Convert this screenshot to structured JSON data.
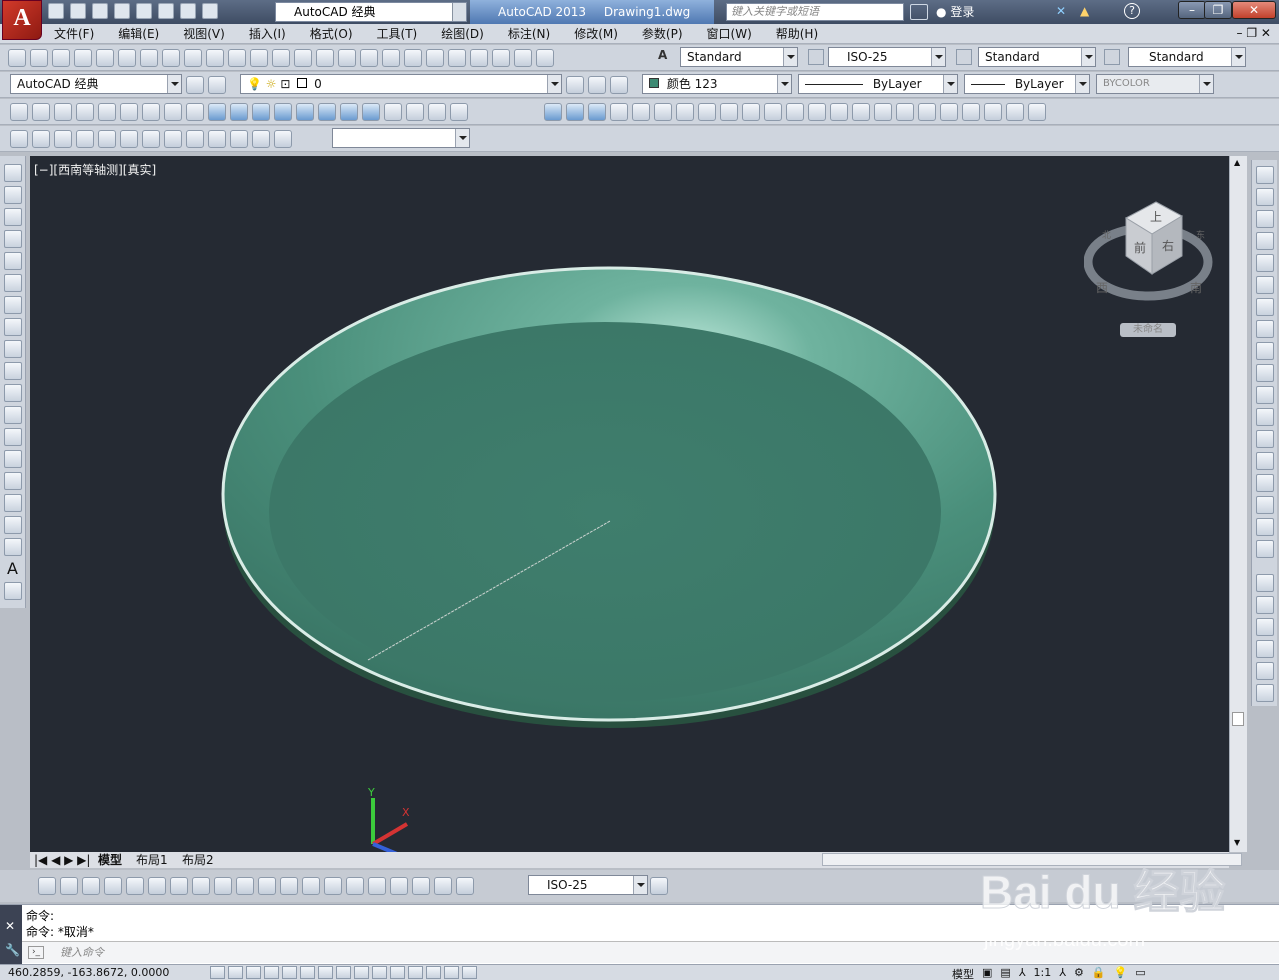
{
  "title_bar": {
    "app_logo": "A",
    "workspace": "AutoCAD 经典",
    "app_name": "AutoCAD 2013",
    "document": "Drawing1.dwg",
    "search_placeholder": "键入关键字或短语",
    "login": "登录"
  },
  "menu": [
    "文件(F)",
    "编辑(E)",
    "视图(V)",
    "插入(I)",
    "格式(O)",
    "工具(T)",
    "绘图(D)",
    "标注(N)",
    "修改(M)",
    "参数(P)",
    "窗口(W)",
    "帮助(H)"
  ],
  "styles_toolbar": {
    "text_style": "Standard",
    "dim_style": "ISO-25",
    "table_style": "Standard",
    "multileader_style": "Standard"
  },
  "layers_toolbar": {
    "workspace": "AutoCAD 经典",
    "layer": "0",
    "color": "颜色 123",
    "linetype": "ByLayer",
    "lineweight": "ByLayer",
    "plotstyle": "BYCOLOR"
  },
  "viewport": {
    "label": "[−][西南等轴测][真实]",
    "viewcube_faces": [
      "上",
      "前",
      "右"
    ],
    "compass": [
      "西",
      "南",
      "北",
      "东"
    ],
    "named_view": "未命名"
  },
  "tabs": [
    "模型",
    "布局1",
    "布局2"
  ],
  "dim_toolbar": {
    "dim_style": "ISO-25"
  },
  "command": {
    "lines": [
      "命令:",
      "命令: *取消*"
    ],
    "input_placeholder": "键入命令"
  },
  "status": {
    "coords": "460.2859,  -163.8672, 0.0000",
    "model_label": "模型",
    "scale": "1:1"
  },
  "watermark": {
    "text": "Bai du 经验",
    "url": "jingyan.baidu.com"
  },
  "colors": {
    "viewport_bg": "#252a33",
    "dish_fill": "#3d7d6c",
    "dish_rim": "#cfe6de"
  }
}
